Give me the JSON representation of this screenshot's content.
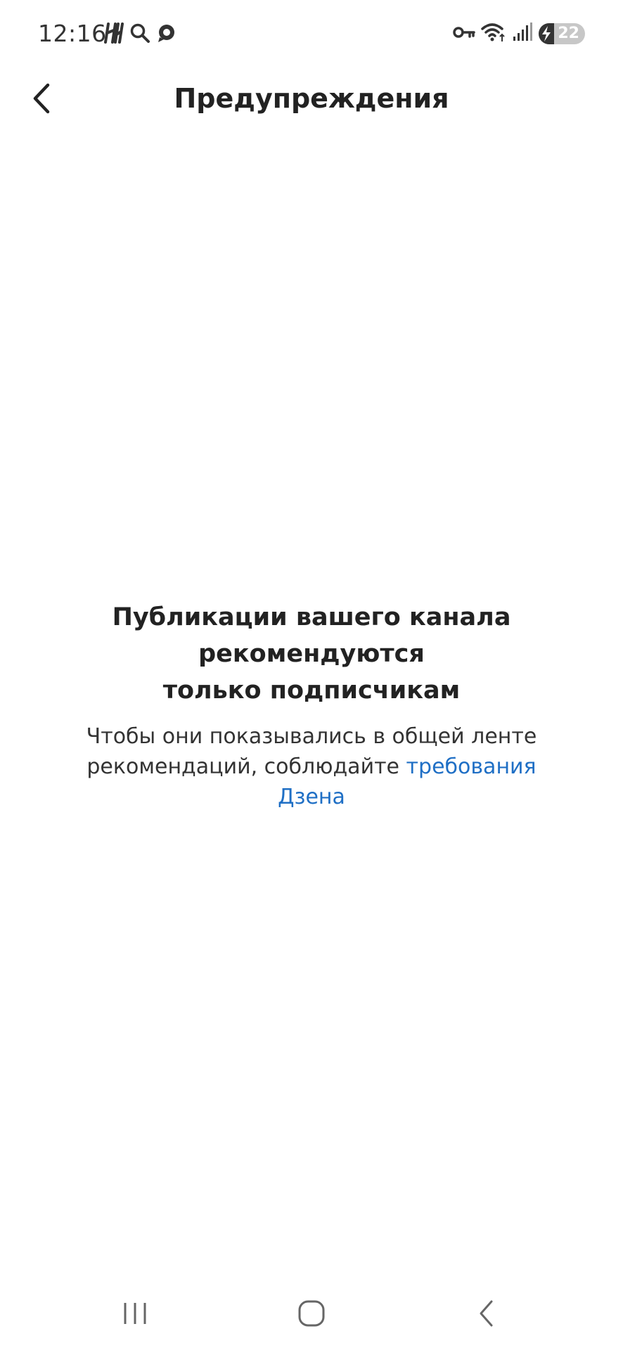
{
  "status_bar": {
    "time": "12:16",
    "battery_level": "22",
    "left_icons": [
      "hh-app-icon",
      "search-icon",
      "chat-bubble-icon"
    ],
    "right_icons": [
      "key-icon",
      "wifi-icon",
      "signal-icon",
      "battery-charging-icon"
    ]
  },
  "header": {
    "title": "Предупреждения",
    "back_icon": "chevron-left-icon"
  },
  "message": {
    "title_lines": [
      "Публикации вашего канала",
      "рекомендуются",
      "только подписчикам"
    ],
    "body_line1": "Чтобы они показывались в общей ленте",
    "body_line2_prefix": "рекомендаций, соблюдайте ",
    "link_part1": "требования",
    "link_part2": "Дзена"
  },
  "colors": {
    "link": "#1f6fc5",
    "text": "#222222",
    "background": "#ffffff"
  },
  "nav_bar": {
    "buttons": [
      "recent-apps-icon",
      "home-icon",
      "back-icon"
    ]
  }
}
